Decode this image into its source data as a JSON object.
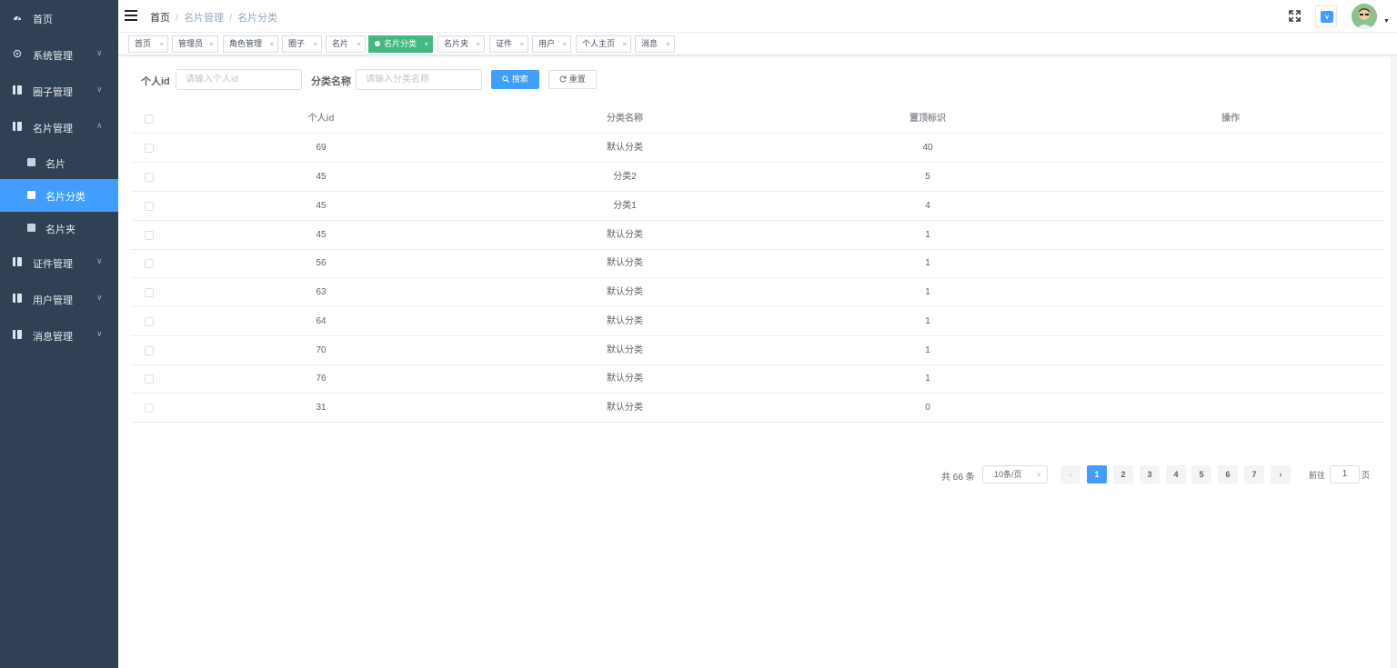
{
  "sidebar": {
    "items": [
      {
        "label": "首页"
      },
      {
        "label": "系统管理"
      },
      {
        "label": "圈子管理"
      },
      {
        "label": "名片管理"
      },
      {
        "label": "名片"
      },
      {
        "label": "名片分类"
      },
      {
        "label": "名片夹"
      },
      {
        "label": "证件管理"
      },
      {
        "label": "用户管理"
      },
      {
        "label": "消息管理"
      }
    ]
  },
  "header": {
    "breadcrumb": [
      "首页",
      "名片管理",
      "名片分类"
    ],
    "separator": "/"
  },
  "tags": [
    "首页",
    "管理员",
    "角色管理",
    "圈子",
    "名片",
    "名片分类",
    "名片夹",
    "证件",
    "用户",
    "个人主页",
    "消息"
  ],
  "search": {
    "id_label": "个人id",
    "id_placeholder": "请输入个人id",
    "name_label": "分类名称",
    "name_placeholder": "请输入分类名称",
    "search_button": "搜索",
    "reset_button": "重置"
  },
  "table": {
    "columns": [
      "个人id",
      "分类名称",
      "置顶标识",
      "操作"
    ],
    "rows": [
      {
        "id": "69",
        "name": "默认分类",
        "top": "40"
      },
      {
        "id": "45",
        "name": "分类2",
        "top": "5"
      },
      {
        "id": "45",
        "name": "分类1",
        "top": "4"
      },
      {
        "id": "45",
        "name": "默认分类",
        "top": "1"
      },
      {
        "id": "56",
        "name": "默认分类",
        "top": "1"
      },
      {
        "id": "63",
        "name": "默认分类",
        "top": "1"
      },
      {
        "id": "64",
        "name": "默认分类",
        "top": "1"
      },
      {
        "id": "70",
        "name": "默认分类",
        "top": "1"
      },
      {
        "id": "76",
        "name": "默认分类",
        "top": "1"
      },
      {
        "id": "31",
        "name": "默认分类",
        "top": "0"
      }
    ]
  },
  "pagination": {
    "total": "共 66 条",
    "page_size": "10条/页",
    "pages": [
      "1",
      "2",
      "3",
      "4",
      "5",
      "6",
      "7"
    ],
    "current": "1",
    "goto_label": "前往",
    "goto_value": "1",
    "page_suffix": "页"
  },
  "colors": {
    "sidebar_bg": "#304156",
    "primary": "#409eff",
    "active_tag": "#42b983"
  }
}
